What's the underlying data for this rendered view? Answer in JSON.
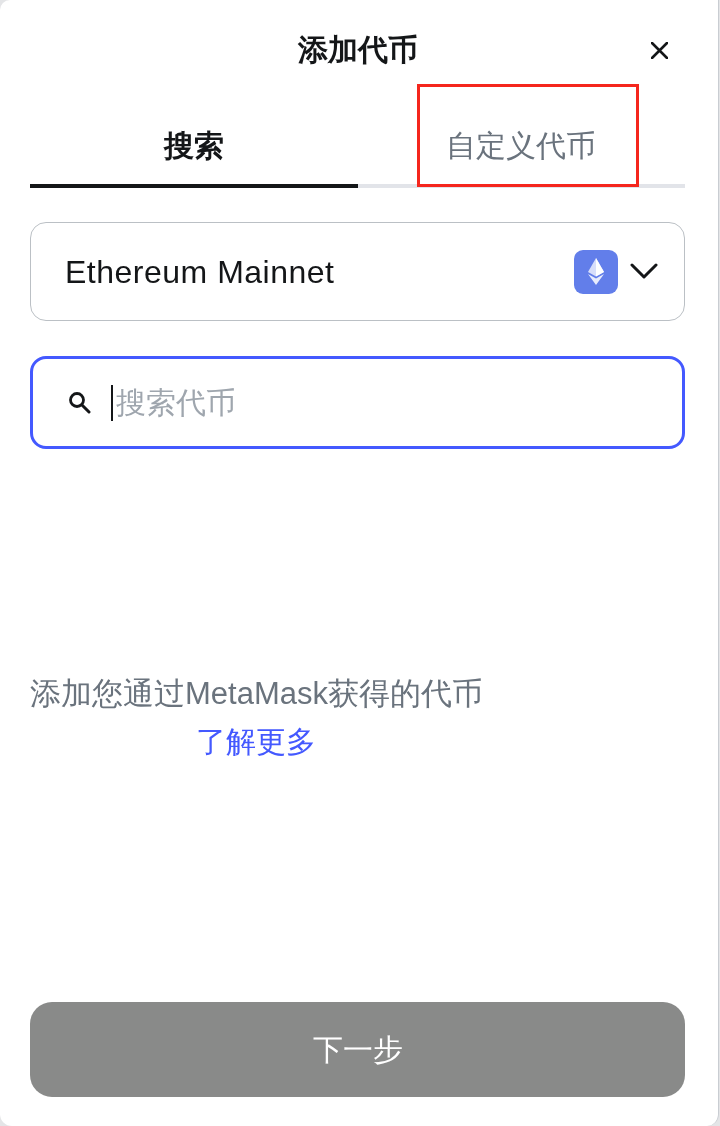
{
  "dialog": {
    "title": "添加代币"
  },
  "tabs": [
    {
      "label": "搜索",
      "selected": true,
      "highlighted": false
    },
    {
      "label": "自定义代币",
      "selected": false,
      "highlighted": true
    }
  ],
  "network_select": {
    "value": "Ethereum Mainnet"
  },
  "search": {
    "placeholder": "搜索代币",
    "focused": true
  },
  "empty_state": {
    "text": "添加您通过MetaMask获得的代币",
    "link": "了解更多"
  },
  "buttons": [
    {
      "label": "下一步",
      "disabled": true
    }
  ]
}
